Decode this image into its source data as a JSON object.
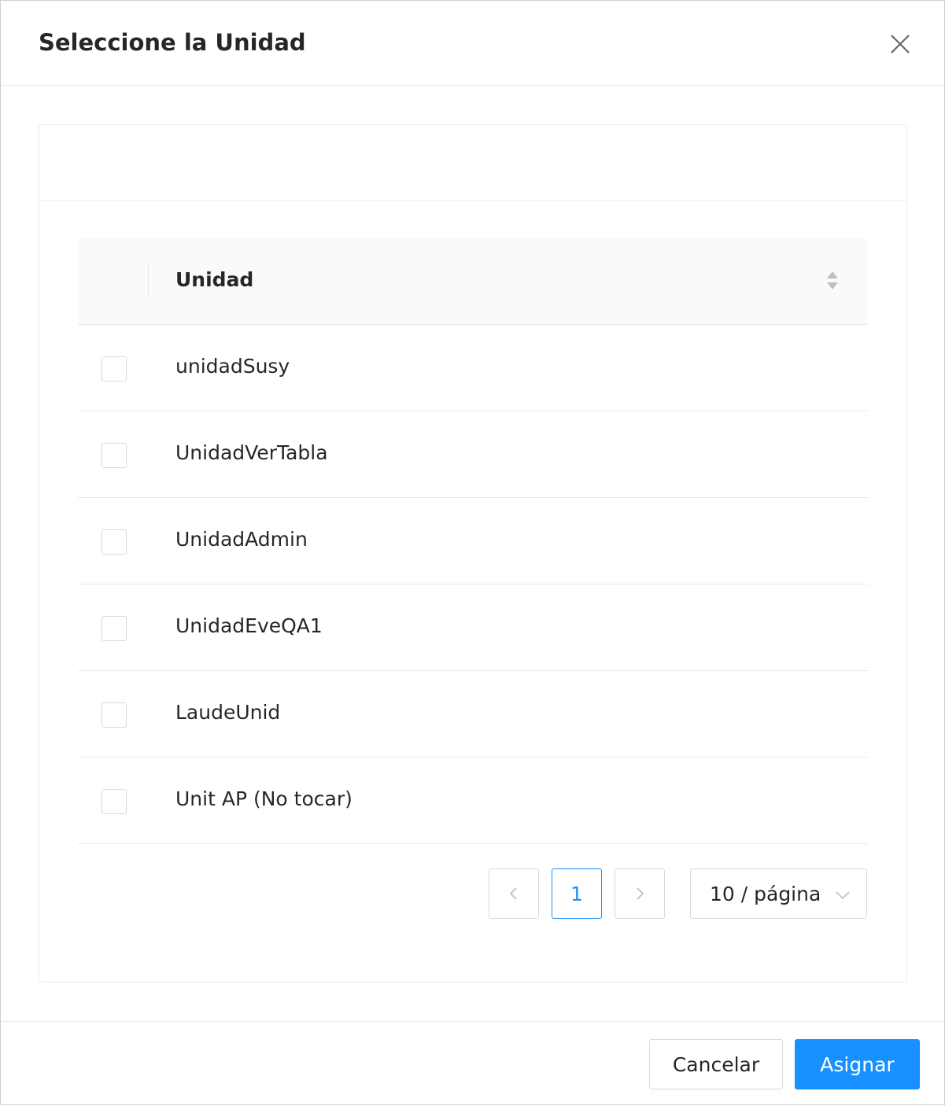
{
  "modal": {
    "title": "Seleccione la Unidad"
  },
  "table": {
    "column_header": "Unidad",
    "rows": [
      {
        "unidad": "unidadSusy",
        "checked": false
      },
      {
        "unidad": "UnidadVerTabla",
        "checked": false
      },
      {
        "unidad": "UnidadAdmin",
        "checked": false
      },
      {
        "unidad": "UnidadEveQA1",
        "checked": false
      },
      {
        "unidad": "LaudeUnid",
        "checked": false
      },
      {
        "unidad": "Unit AP (No tocar)",
        "checked": false
      }
    ]
  },
  "pagination": {
    "current_page": "1",
    "page_size_label": "10 / página"
  },
  "footer": {
    "cancel_label": "Cancelar",
    "assign_label": "Asignar"
  },
  "colors": {
    "primary": "#1890ff",
    "border": "#d9d9d9",
    "header_bg": "#fafafa"
  }
}
